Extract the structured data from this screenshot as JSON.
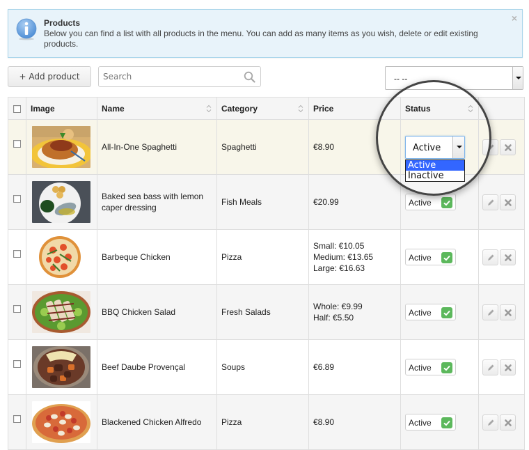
{
  "info": {
    "title": "Products",
    "text": "Below you can find a list with all products in the menu. You can add as many items as you wish, delete or edit existing products.",
    "close": "×",
    "icon": "info-icon"
  },
  "toolbar": {
    "add_label": "+ Add product",
    "search_placeholder": "Search",
    "search_value": "",
    "filter_value": "-- --"
  },
  "table": {
    "columns": [
      "Image",
      "Name",
      "Category",
      "Price",
      "Status"
    ],
    "rows": [
      {
        "name": "All-In-One Spaghetti",
        "category": "Spaghetti",
        "price": [
          "€8.90"
        ],
        "status": "Active",
        "image": "spaghetti",
        "selected": false
      },
      {
        "name": "Baked sea bass with lemon caper dressing",
        "category": "Fish Meals",
        "price": [
          "€20.99"
        ],
        "status": "Active",
        "image": "sea-bass",
        "selected": false
      },
      {
        "name": "Barbeque Chicken",
        "category": "Pizza",
        "price": [
          "Small: €10.05",
          "Medium: €13.65",
          "Large: €16.63"
        ],
        "status": "Active",
        "image": "pizza",
        "selected": false
      },
      {
        "name": "BBQ Chicken Salad",
        "category": "Fresh Salads",
        "price": [
          "Whole: €9.99",
          "Half: €5.50"
        ],
        "status": "Active",
        "image": "salad",
        "selected": false
      },
      {
        "name": "Beef Daube Provençal",
        "category": "Soups",
        "price": [
          "€6.89"
        ],
        "status": "Active",
        "image": "beef-stew",
        "selected": false
      },
      {
        "name": "Blackened Chicken Alfredo",
        "category": "Pizza",
        "price": [
          "€8.90"
        ],
        "status": "Active",
        "image": "pizza-mushroom",
        "selected": false
      }
    ]
  },
  "status_dropdown": {
    "current": "Active",
    "options": [
      "Active",
      "Inactive"
    ],
    "highlighted": "Active"
  },
  "colors": {
    "info_bg": "#e8f3fa",
    "info_border": "#a9d5ea",
    "active_check": "#5cb85c",
    "dropdown_highlight": "#3366ff",
    "row_highlight": "#f8f6ea"
  }
}
